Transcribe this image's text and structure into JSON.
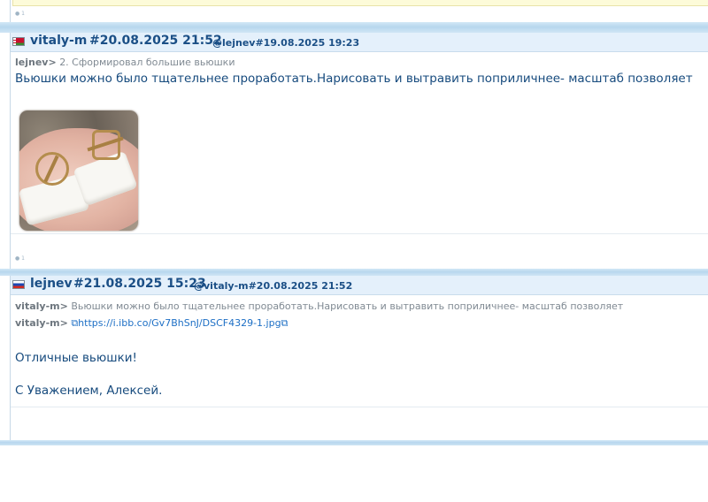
{
  "colors": {
    "author": "#1b4f86",
    "body_text": "#174b7e",
    "link": "#1d6fc5",
    "header_bg": "#e4f0fb"
  },
  "post_prev": {
    "counter": "1"
  },
  "post1": {
    "flag_icon": "flag-icon",
    "author": "vitaly-m",
    "date": "#20.08.2025 21:52",
    "reply_to": "@lejnev#19.08.2025 19:23",
    "quote_author": "lejnev>",
    "quote_text": "2. Сформировал большие вьюшки",
    "body": "Вьюшки можно было тщательнее проработать.Нарисовать и вытравить поприличнее- масштаб позволяет",
    "counter": "1"
  },
  "post2": {
    "flag_icon": "flag-icon",
    "author": "lejnev",
    "date": "#21.08.2025 15:23",
    "reply_to": "@vitaly-m#20.08.2025 21:52",
    "quote1_author": "vitaly-m>",
    "quote1_text": "Вьюшки можно было тщательнее проработать.Нарисовать и вытравить поприличнее- масштаб позволяет",
    "quote2_author": "vitaly-m>",
    "quote2_link": "https://i.ibb.co/Gv7BhSnJ/DSCF4329-1.jpg",
    "line1": "Отличные вьюшки!",
    "line2": "С Уважением, Алексей."
  }
}
